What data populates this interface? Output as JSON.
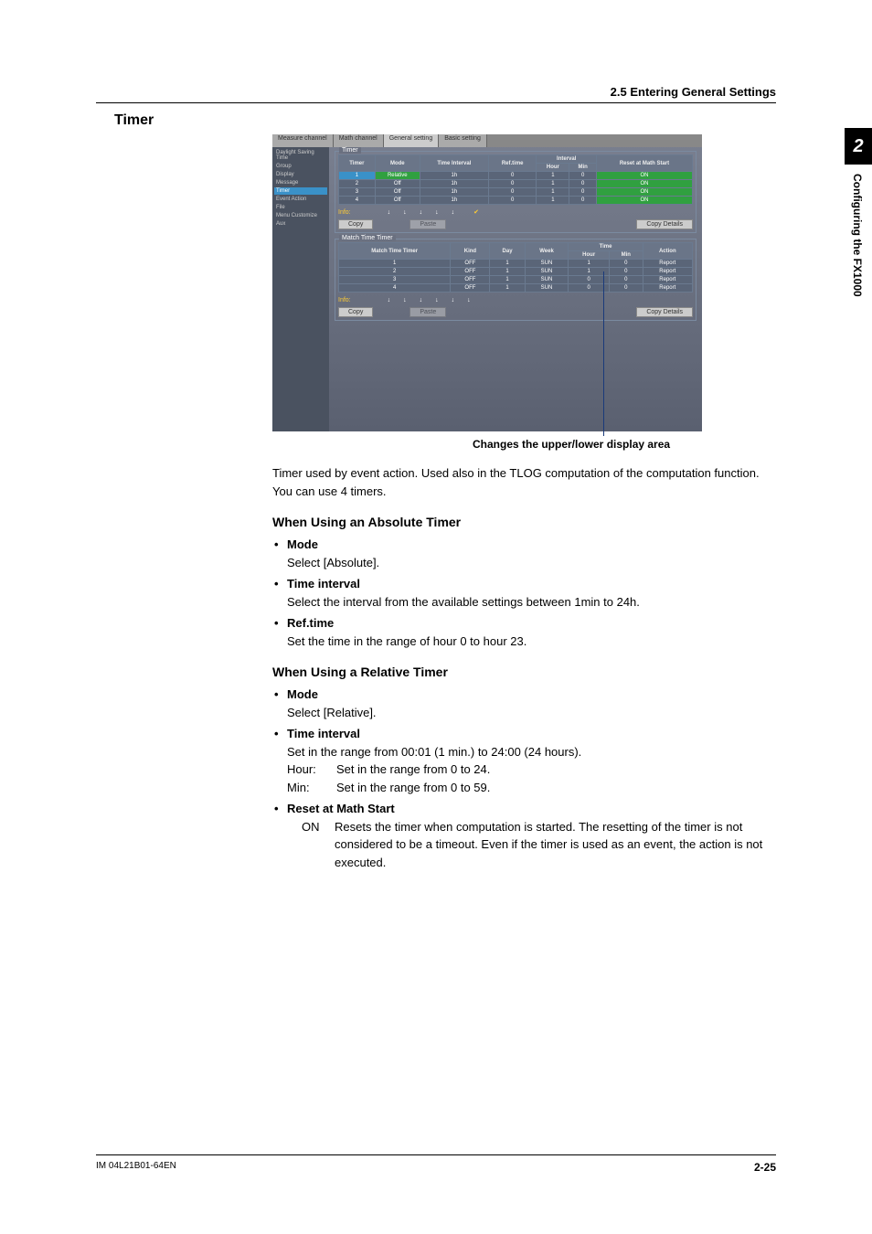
{
  "header": {
    "section_label": "2.5  Entering General Settings"
  },
  "section_title": "Timer",
  "side_tab": {
    "number": "2",
    "text": "Configuring the FX1000"
  },
  "screenshot": {
    "tabs": [
      "Measure channel",
      "Math channel",
      "General setting",
      "Basic setting"
    ],
    "active_tab": 2,
    "sidebar": [
      "Daylight Saving Time",
      "Group",
      "Display",
      "Message",
      "Timer",
      "Event Action",
      "File",
      "Menu Customize",
      "Aux"
    ],
    "sidebar_selected": 4,
    "timer_panel_label": "Timer",
    "timer_headers": [
      "Timer",
      "Mode",
      "Time Interval",
      "Ref.time",
      "Interval Hour",
      "Interval Min",
      "Reset at Math Start"
    ],
    "timer_rows": [
      {
        "n": "1",
        "mode": "Relative",
        "ti": "1h",
        "ref": "0",
        "h": "1",
        "m": "0",
        "reset": "ON"
      },
      {
        "n": "2",
        "mode": "Off",
        "ti": "1h",
        "ref": "0",
        "h": "1",
        "m": "0",
        "reset": "ON"
      },
      {
        "n": "3",
        "mode": "Off",
        "ti": "1h",
        "ref": "0",
        "h": "1",
        "m": "0",
        "reset": "ON"
      },
      {
        "n": "4",
        "mode": "Off",
        "ti": "1h",
        "ref": "0",
        "h": "1",
        "m": "0",
        "reset": "ON"
      }
    ],
    "info_label": "Info:",
    "copy_btn": "Copy",
    "paste_btn": "Paste",
    "copy_details_btn": "Copy Details",
    "mtt_panel_label": "Match Time Timer",
    "mtt_headers": [
      "Match Time Timer",
      "Kind",
      "Day",
      "Week",
      "Time Hour",
      "Time Min",
      "Action"
    ],
    "mtt_rows": [
      {
        "n": "1",
        "kind": "OFF",
        "day": "1",
        "week": "SUN",
        "h": "1",
        "m": "0",
        "act": "Report"
      },
      {
        "n": "2",
        "kind": "OFF",
        "day": "1",
        "week": "SUN",
        "h": "1",
        "m": "0",
        "act": "Report"
      },
      {
        "n": "3",
        "kind": "OFF",
        "day": "1",
        "week": "SUN",
        "h": "0",
        "m": "0",
        "act": "Report"
      },
      {
        "n": "4",
        "kind": "OFF",
        "day": "1",
        "week": "SUN",
        "h": "0",
        "m": "0",
        "act": "Report"
      }
    ]
  },
  "caption": "Changes the upper/lower display area",
  "intro": "Timer used by event action.  Used also in the TLOG computation of the computation function. You can use 4 timers.",
  "abs": {
    "title": "When Using an Absolute Timer",
    "mode_t": "Mode",
    "mode_b": "Select [Absolute].",
    "ti_t": "Time interval",
    "ti_b": "Select the interval from the available settings between 1min to 24h.",
    "rt_t": "Ref.time",
    "rt_b": "Set the time in the range of hour 0 to hour 23."
  },
  "rel": {
    "title": "When Using a Relative Timer",
    "mode_t": "Mode",
    "mode_b": "Select [Relative].",
    "ti_t": "Time interval",
    "ti_b1": "Set in the range from 00:01 (1 min.) to 24:00 (24 hours).",
    "ti_hour_k": "Hour:",
    "ti_hour_v": "Set in the range from 0 to 24.",
    "ti_min_k": "Min:",
    "ti_min_v": "Set in the range from 0 to 59.",
    "rm_t": "Reset at Math Start",
    "rm_on_k": "ON",
    "rm_on_v": "Resets the timer when computation is started.  The resetting of the timer is not considered to be a timeout.  Even if the timer is used as an event, the action is not executed."
  },
  "footer": {
    "doc_id": "IM 04L21B01-64EN",
    "page": "2-25"
  }
}
